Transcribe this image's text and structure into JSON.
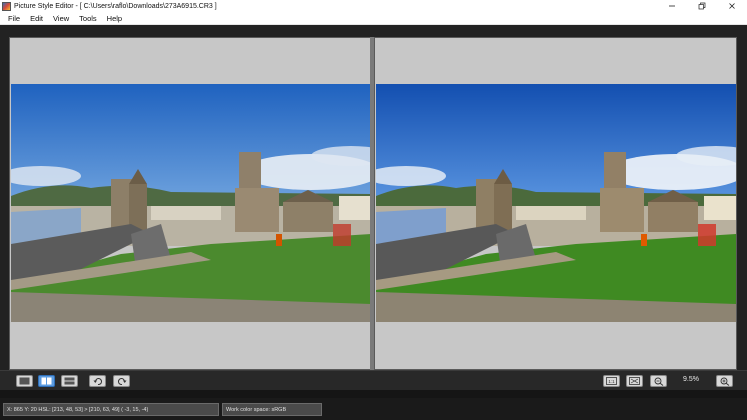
{
  "window": {
    "title": "Picture Style Editor - [ C:\\Users\\raflo\\Downloads\\273A6915.CR3 ]",
    "minimize_icon": "minimize-icon",
    "maximize_icon": "restore-icon",
    "close_icon": "close-icon"
  },
  "menu": [
    "File",
    "Edit",
    "View",
    "Tools",
    "Help"
  ],
  "panels": {
    "left_image": "photo-original",
    "right_image": "photo-adjusted"
  },
  "toolbar": {
    "view_buttons": [
      "single-view-icon",
      "side-by-side-view-icon",
      "split-view-icon"
    ],
    "rotate_buttons": [
      "rotate-left-icon",
      "rotate-right-icon"
    ],
    "right_buttons": [
      "actual-size-icon",
      "fit-to-window-icon",
      "zoom-out-icon",
      "zoom-in-icon"
    ],
    "zoom_level": "9.5%",
    "active_view": "side-by-side"
  },
  "status": {
    "coords": "X: 865  Y: 20  HSL: [213, 48, 53] > [210, 63, 49]  ( -3, 15, -4)",
    "color_space": "Work color space: sRGB"
  },
  "colors": {
    "sky_left": "#2f74c8",
    "sky_right": "#1f5fc0",
    "grass": "#4b8a2e",
    "accent_active_button": "#5b9be0"
  }
}
